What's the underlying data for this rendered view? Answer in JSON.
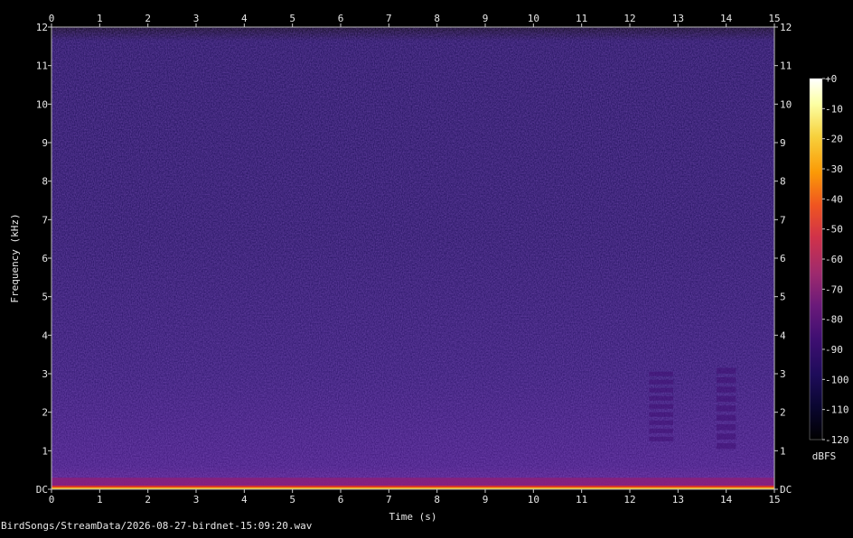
{
  "file_caption": "BirdSongs/StreamData/2026-08-27-birdnet-15:09:20.wav",
  "chart_data": {
    "type": "heatmap",
    "title": "",
    "xlabel": "Time (s)",
    "ylabel": "Frequency (kHz)",
    "xlim": [
      0,
      15
    ],
    "ylim": [
      0,
      12
    ],
    "x_ticks": [
      "0",
      "1",
      "2",
      "3",
      "4",
      "5",
      "6",
      "7",
      "8",
      "9",
      "10",
      "11",
      "12",
      "13",
      "14",
      "15"
    ],
    "y_ticks": [
      "DC",
      "1",
      "2",
      "3",
      "4",
      "5",
      "6",
      "7",
      "8",
      "9",
      "10",
      "11",
      "12"
    ],
    "colorbar": {
      "label": "dBFS",
      "range": [
        -120,
        0
      ],
      "ticks": [
        "+0",
        "-10",
        "-20",
        "-30",
        "-40",
        "-50",
        "-60",
        "-70",
        "-80",
        "-90",
        "-100",
        "-110",
        "-120"
      ],
      "colormap": [
        "#000000",
        "#0a0630",
        "#1e0c5a",
        "#3f0f72",
        "#6a1a7a",
        "#9e2a6e",
        "#d0324a",
        "#f05520",
        "#fb9a06",
        "#f7d13d",
        "#fcffa4",
        "#ffffff"
      ]
    },
    "background_level_dbfs": -100,
    "low_frequency_energy_kHz": [
      0,
      0.3
    ],
    "events": [
      {
        "t_start": 12.4,
        "t_end": 12.9,
        "f_low_kHz": 1.2,
        "f_high_kHz": 3.1,
        "level_dbfs": -88
      },
      {
        "t_start": 13.8,
        "t_end": 14.2,
        "f_low_kHz": 1.0,
        "f_high_kHz": 3.2,
        "level_dbfs": -90
      }
    ]
  }
}
